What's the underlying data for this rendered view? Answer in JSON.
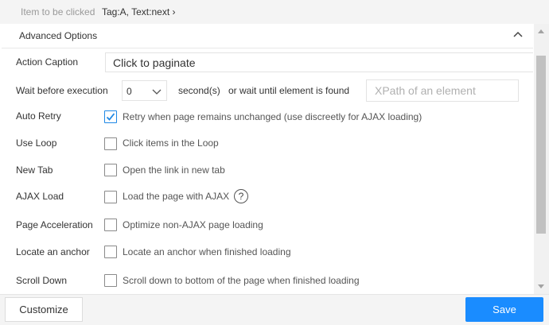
{
  "header": {
    "item_label": "Item to be clicked",
    "item_value": "Tag:A, Text:next ›"
  },
  "section": {
    "title": "Advanced Options"
  },
  "action_caption": {
    "label": "Action Caption",
    "value": "Click to paginate"
  },
  "wait": {
    "label": "Wait before execution",
    "selected": "0",
    "unit_text": "second(s)",
    "until_text": "or wait until element is found",
    "xpath_placeholder": "XPath of an element"
  },
  "options": [
    {
      "label": "Auto Retry",
      "text": "Retry when page remains unchanged (use discreetly for AJAX loading)",
      "checked": true
    },
    {
      "label": "Use Loop",
      "text": "Click items in the Loop",
      "checked": false
    },
    {
      "label": "New Tab",
      "text": "Open the link in new tab",
      "checked": false
    },
    {
      "label": "AJAX Load",
      "text": "Load the page with AJAX",
      "checked": false,
      "help": "?"
    },
    {
      "label": "Page Acceleration",
      "text": "Optimize non-AJAX page loading",
      "checked": false
    },
    {
      "label": "Locate an anchor",
      "text": "Locate an anchor when finished loading",
      "checked": false
    },
    {
      "label": "Scroll Down",
      "text": "Scroll down to bottom of the page when finished loading",
      "checked": false
    }
  ],
  "footer": {
    "customize_label": "Customize",
    "save_label": "Save"
  },
  "colors": {
    "accent": "#1a8cff",
    "check": "#1e88e5"
  },
  "icons": {
    "collapse": "chevron-up-icon",
    "dropdown": "chevron-down-icon",
    "check": "checkmark-icon",
    "help": "question-circle-icon"
  }
}
